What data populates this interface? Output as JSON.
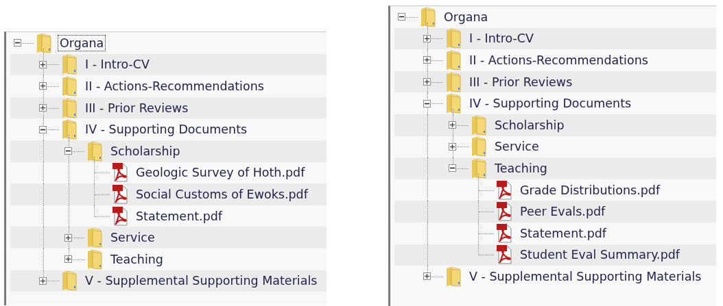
{
  "panels": [
    {
      "tree": [
        {
          "label": "Organa",
          "kind": "folder",
          "expanded": true,
          "selected": true,
          "children": [
            {
              "label": "I - Intro-CV",
              "kind": "folder",
              "expanded": false,
              "selected": false
            },
            {
              "label": "II - Actions-Recommendations",
              "kind": "folder",
              "expanded": false,
              "selected": false
            },
            {
              "label": "III - Prior Reviews",
              "kind": "folder",
              "expanded": false,
              "selected": false
            },
            {
              "label": "IV - Supporting Documents",
              "kind": "folder",
              "expanded": true,
              "selected": false,
              "children": [
                {
                  "label": "Scholarship",
                  "kind": "folder",
                  "expanded": true,
                  "selected": false,
                  "children": [
                    {
                      "label": "Geologic Survey of Hoth.pdf",
                      "kind": "pdf",
                      "selected": false
                    },
                    {
                      "label": "Social Customs of Ewoks.pdf",
                      "kind": "pdf",
                      "selected": false
                    },
                    {
                      "label": "Statement.pdf",
                      "kind": "pdf",
                      "selected": false
                    }
                  ]
                },
                {
                  "label": "Service",
                  "kind": "folder",
                  "expanded": false,
                  "selected": false
                },
                {
                  "label": "Teaching",
                  "kind": "folder",
                  "expanded": false,
                  "selected": false
                }
              ]
            },
            {
              "label": "V - Supplemental Supporting Materials",
              "kind": "folder",
              "expanded": false,
              "selected": false
            }
          ]
        }
      ]
    },
    {
      "tree": [
        {
          "label": "Organa",
          "kind": "folder",
          "expanded": true,
          "selected": false,
          "children": [
            {
              "label": "I - Intro-CV",
              "kind": "folder",
              "expanded": false,
              "selected": false
            },
            {
              "label": "II - Actions-Recommendations",
              "kind": "folder",
              "expanded": false,
              "selected": false
            },
            {
              "label": "III - Prior Reviews",
              "kind": "folder",
              "expanded": false,
              "selected": false
            },
            {
              "label": "IV - Supporting Documents",
              "kind": "folder",
              "expanded": true,
              "selected": false,
              "children": [
                {
                  "label": "Scholarship",
                  "kind": "folder",
                  "expanded": false,
                  "selected": false
                },
                {
                  "label": "Service",
                  "kind": "folder",
                  "expanded": false,
                  "selected": false
                },
                {
                  "label": "Teaching",
                  "kind": "folder",
                  "expanded": true,
                  "selected": false,
                  "children": [
                    {
                      "label": "Grade Distributions.pdf",
                      "kind": "pdf",
                      "selected": false
                    },
                    {
                      "label": "Peer Evals.pdf",
                      "kind": "pdf",
                      "selected": false
                    },
                    {
                      "label": "Statement.pdf",
                      "kind": "pdf",
                      "selected": false
                    },
                    {
                      "label": "Student Eval Summary.pdf",
                      "kind": "pdf",
                      "selected": false
                    }
                  ]
                }
              ]
            },
            {
              "label": "V - Supplemental Supporting Materials",
              "kind": "folder",
              "expanded": false,
              "selected": false
            }
          ]
        }
      ]
    }
  ]
}
